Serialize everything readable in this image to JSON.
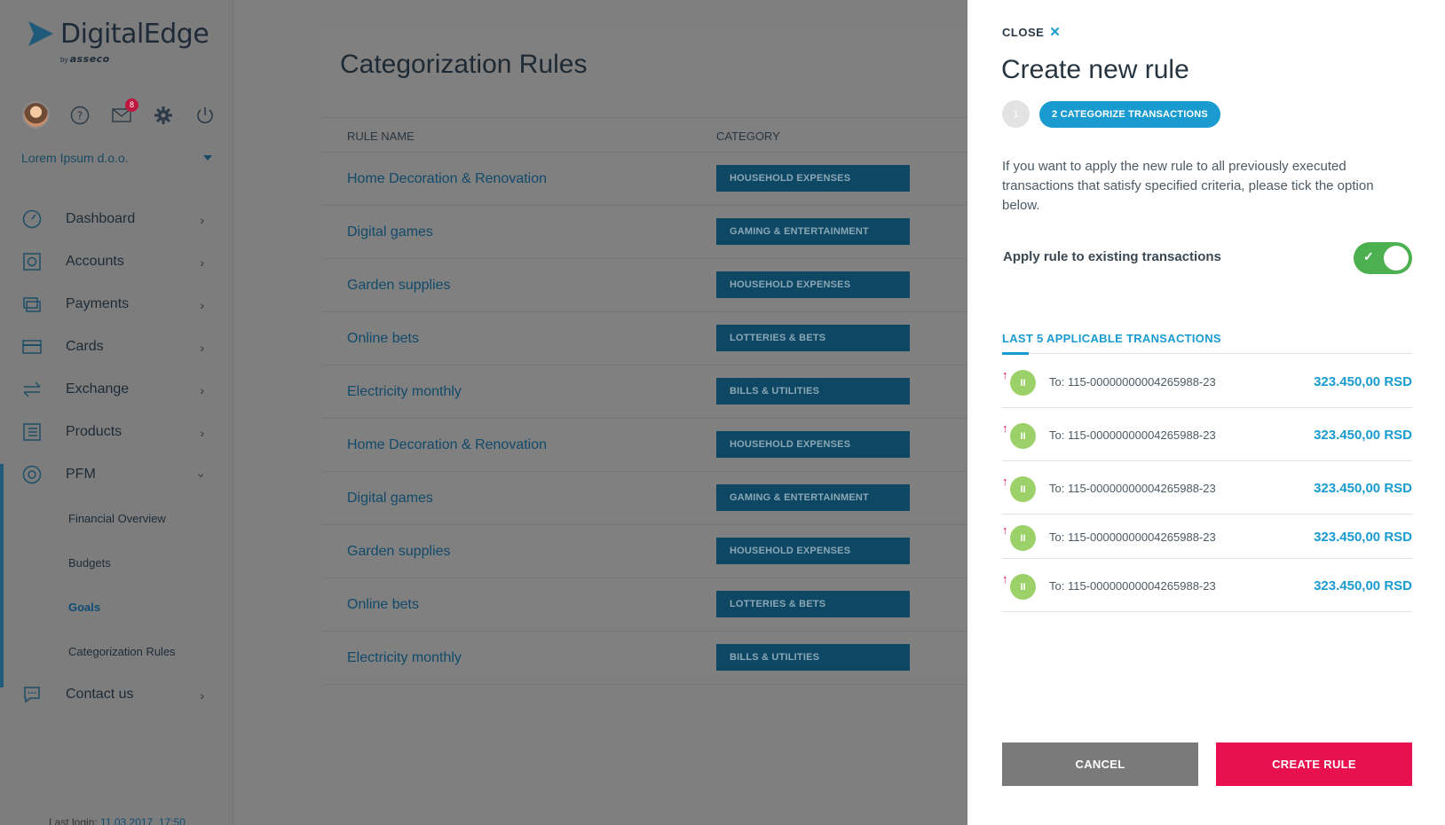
{
  "app": {
    "logo_text": "DigitalEdge",
    "logo_by": "by",
    "logo_brand": "asseco"
  },
  "user": {
    "company": "Lorem Ipsum d.o.o.",
    "mail_count": "8"
  },
  "sidebar": {
    "items": [
      {
        "label": "Dashboard",
        "icon": "dashboard-icon"
      },
      {
        "label": "Accounts",
        "icon": "accounts-icon"
      },
      {
        "label": "Payments",
        "icon": "payments-icon"
      },
      {
        "label": "Cards",
        "icon": "cards-icon"
      },
      {
        "label": "Exchange",
        "icon": "exchange-icon"
      },
      {
        "label": "Products",
        "icon": "products-icon"
      },
      {
        "label": "PFM",
        "icon": "pfm-icon"
      }
    ],
    "pfm_sub": [
      "Financial Overview",
      "Budgets",
      "Goals",
      "Categorization Rules"
    ],
    "contact": "Contact us",
    "last_login_label": "Last login:",
    "last_login_value": "11.03.2017. 17:50"
  },
  "main": {
    "title": "Categorization Rules",
    "col_rule": "RULE NAME",
    "col_category": "CATEGORY",
    "rows": [
      {
        "name": "Home Decoration & Renovation",
        "category": "HOUSEHOLD EXPENSES"
      },
      {
        "name": "Digital games",
        "category": "GAMING & ENTERTAINMENT"
      },
      {
        "name": "Garden supplies",
        "category": "HOUSEHOLD EXPENSES"
      },
      {
        "name": "Online bets",
        "category": "LOTTERIES & BETS"
      },
      {
        "name": "Electricity monthly",
        "category": "BILLS & UTILITIES"
      },
      {
        "name": "Home Decoration & Renovation",
        "category": "HOUSEHOLD EXPENSES"
      },
      {
        "name": "Digital games",
        "category": "GAMING & ENTERTAINMENT"
      },
      {
        "name": "Garden supplies",
        "category": "HOUSEHOLD EXPENSES"
      },
      {
        "name": "Online bets",
        "category": "LOTTERIES & BETS"
      },
      {
        "name": "Electricity monthly",
        "category": "BILLS & UTILITIES"
      }
    ]
  },
  "drawer": {
    "close": "CLOSE",
    "title": "Create new rule",
    "step1": "1",
    "step2": "2 CATEGORIZE TRANSACTIONS",
    "info": "If you want to apply the new rule to all previously executed transactions that satisfy specified criteria, please tick the option below.",
    "apply_label": "Apply rule to existing transactions",
    "apply_on": true,
    "last5_title": "LAST 5 APPLICABLE TRANSACTIONS",
    "transactions": [
      {
        "to": "To: 115-00000000004265988-23",
        "amount": "323.450,00 RSD",
        "initials": "II"
      },
      {
        "to": "To: 115-00000000004265988-23",
        "amount": "323.450,00 RSD",
        "initials": "II"
      },
      {
        "to": "To: 115-00000000004265988-23",
        "amount": "323.450,00 RSD",
        "initials": "II"
      },
      {
        "to": "To: 115-00000000004265988-23",
        "amount": "323.450,00 RSD",
        "initials": "II"
      },
      {
        "to": "To: 115-00000000004265988-23",
        "amount": "323.450,00 RSD",
        "initials": "II"
      }
    ],
    "cancel": "CANCEL",
    "create": "CREATE RULE"
  },
  "colors": {
    "accent": "#1a9bd0",
    "primary_button": "#e8104f",
    "toggle_on": "#4caf50",
    "category_badge": "#0e4763"
  }
}
